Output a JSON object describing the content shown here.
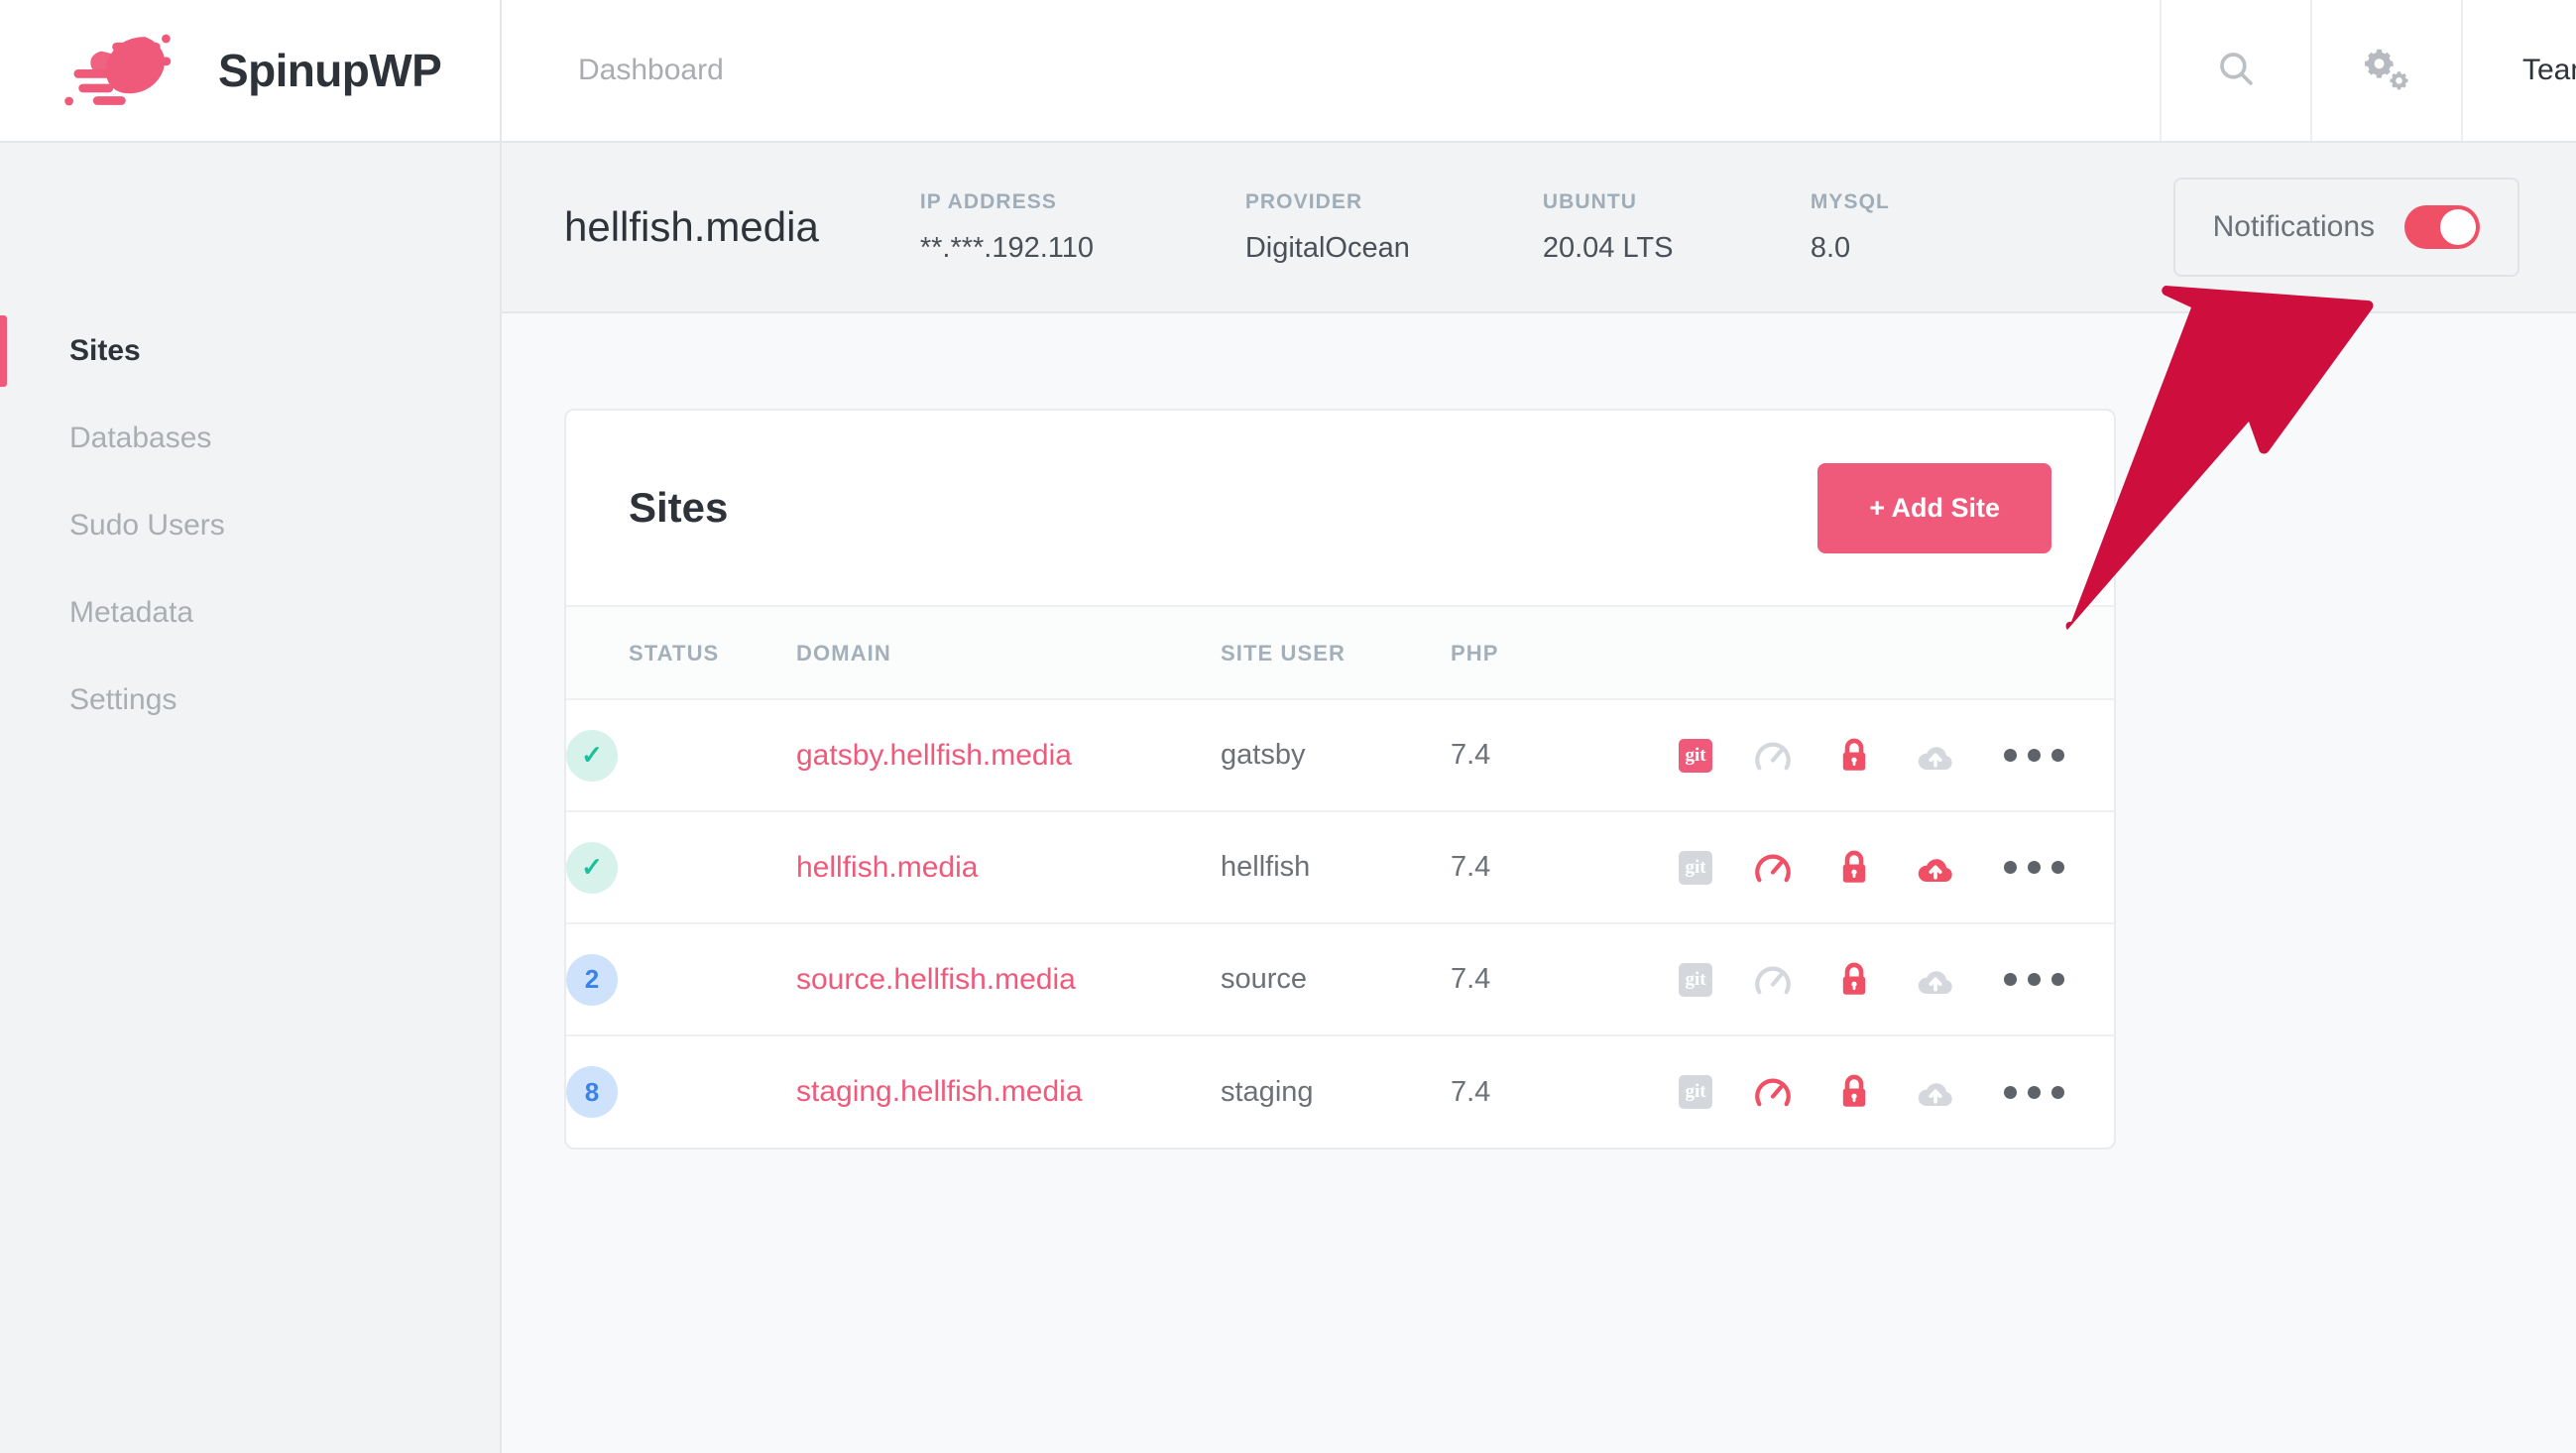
{
  "brand": {
    "name": "SpinupWP",
    "logo_icon": "spinupwp-swoosh-logo",
    "accent_color": "#ef5a7b",
    "annotation_arrow_color": "#ce0e3c"
  },
  "topbar": {
    "title": "Dashboard",
    "search_icon": "search-icon",
    "settings_icon": "gears-icon",
    "teams_label": "Teams"
  },
  "server": {
    "name": "hellfish.media",
    "meta": [
      {
        "label": "IP ADDRESS",
        "value": "**.***.192.110"
      },
      {
        "label": "PROVIDER",
        "value": "DigitalOcean"
      },
      {
        "label": "UBUNTU",
        "value": "20.04 LTS"
      },
      {
        "label": "MYSQL",
        "value": "8.0"
      }
    ],
    "notifications": {
      "label": "Notifications",
      "state": "on"
    }
  },
  "sidebar": {
    "items": [
      {
        "label": "Sites",
        "active": true
      },
      {
        "label": "Databases",
        "active": false
      },
      {
        "label": "Sudo Users",
        "active": false
      },
      {
        "label": "Metadata",
        "active": false
      },
      {
        "label": "Settings",
        "active": false
      }
    ]
  },
  "sites_card": {
    "title": "Sites",
    "add_button": "+ Add Site",
    "columns": [
      "STATUS",
      "DOMAIN",
      "SITE USER",
      "PHP",
      ""
    ],
    "rows": [
      {
        "status": {
          "type": "check",
          "value": "✓"
        },
        "domain": "gatsby.hellfish.media",
        "site_user": "gatsby",
        "php": "7.4",
        "icons": {
          "git": "on",
          "gauge": "off",
          "lock": "on",
          "cloud": "off",
          "menu": "more-options"
        }
      },
      {
        "status": {
          "type": "check",
          "value": "✓"
        },
        "domain": "hellfish.media",
        "site_user": "hellfish",
        "php": "7.4",
        "icons": {
          "git": "off",
          "gauge": "on",
          "lock": "on",
          "cloud": "on",
          "menu": "more-options"
        }
      },
      {
        "status": {
          "type": "count",
          "value": "2"
        },
        "domain": "source.hellfish.media",
        "site_user": "source",
        "php": "7.4",
        "icons": {
          "git": "off",
          "gauge": "off",
          "lock": "on",
          "cloud": "off",
          "menu": "more-options"
        }
      },
      {
        "status": {
          "type": "count",
          "value": "8"
        },
        "domain": "staging.hellfish.media",
        "site_user": "staging",
        "php": "7.4",
        "icons": {
          "git": "off",
          "gauge": "on",
          "lock": "on",
          "cloud": "off",
          "menu": "more-options"
        }
      }
    ],
    "git_label": "git"
  }
}
